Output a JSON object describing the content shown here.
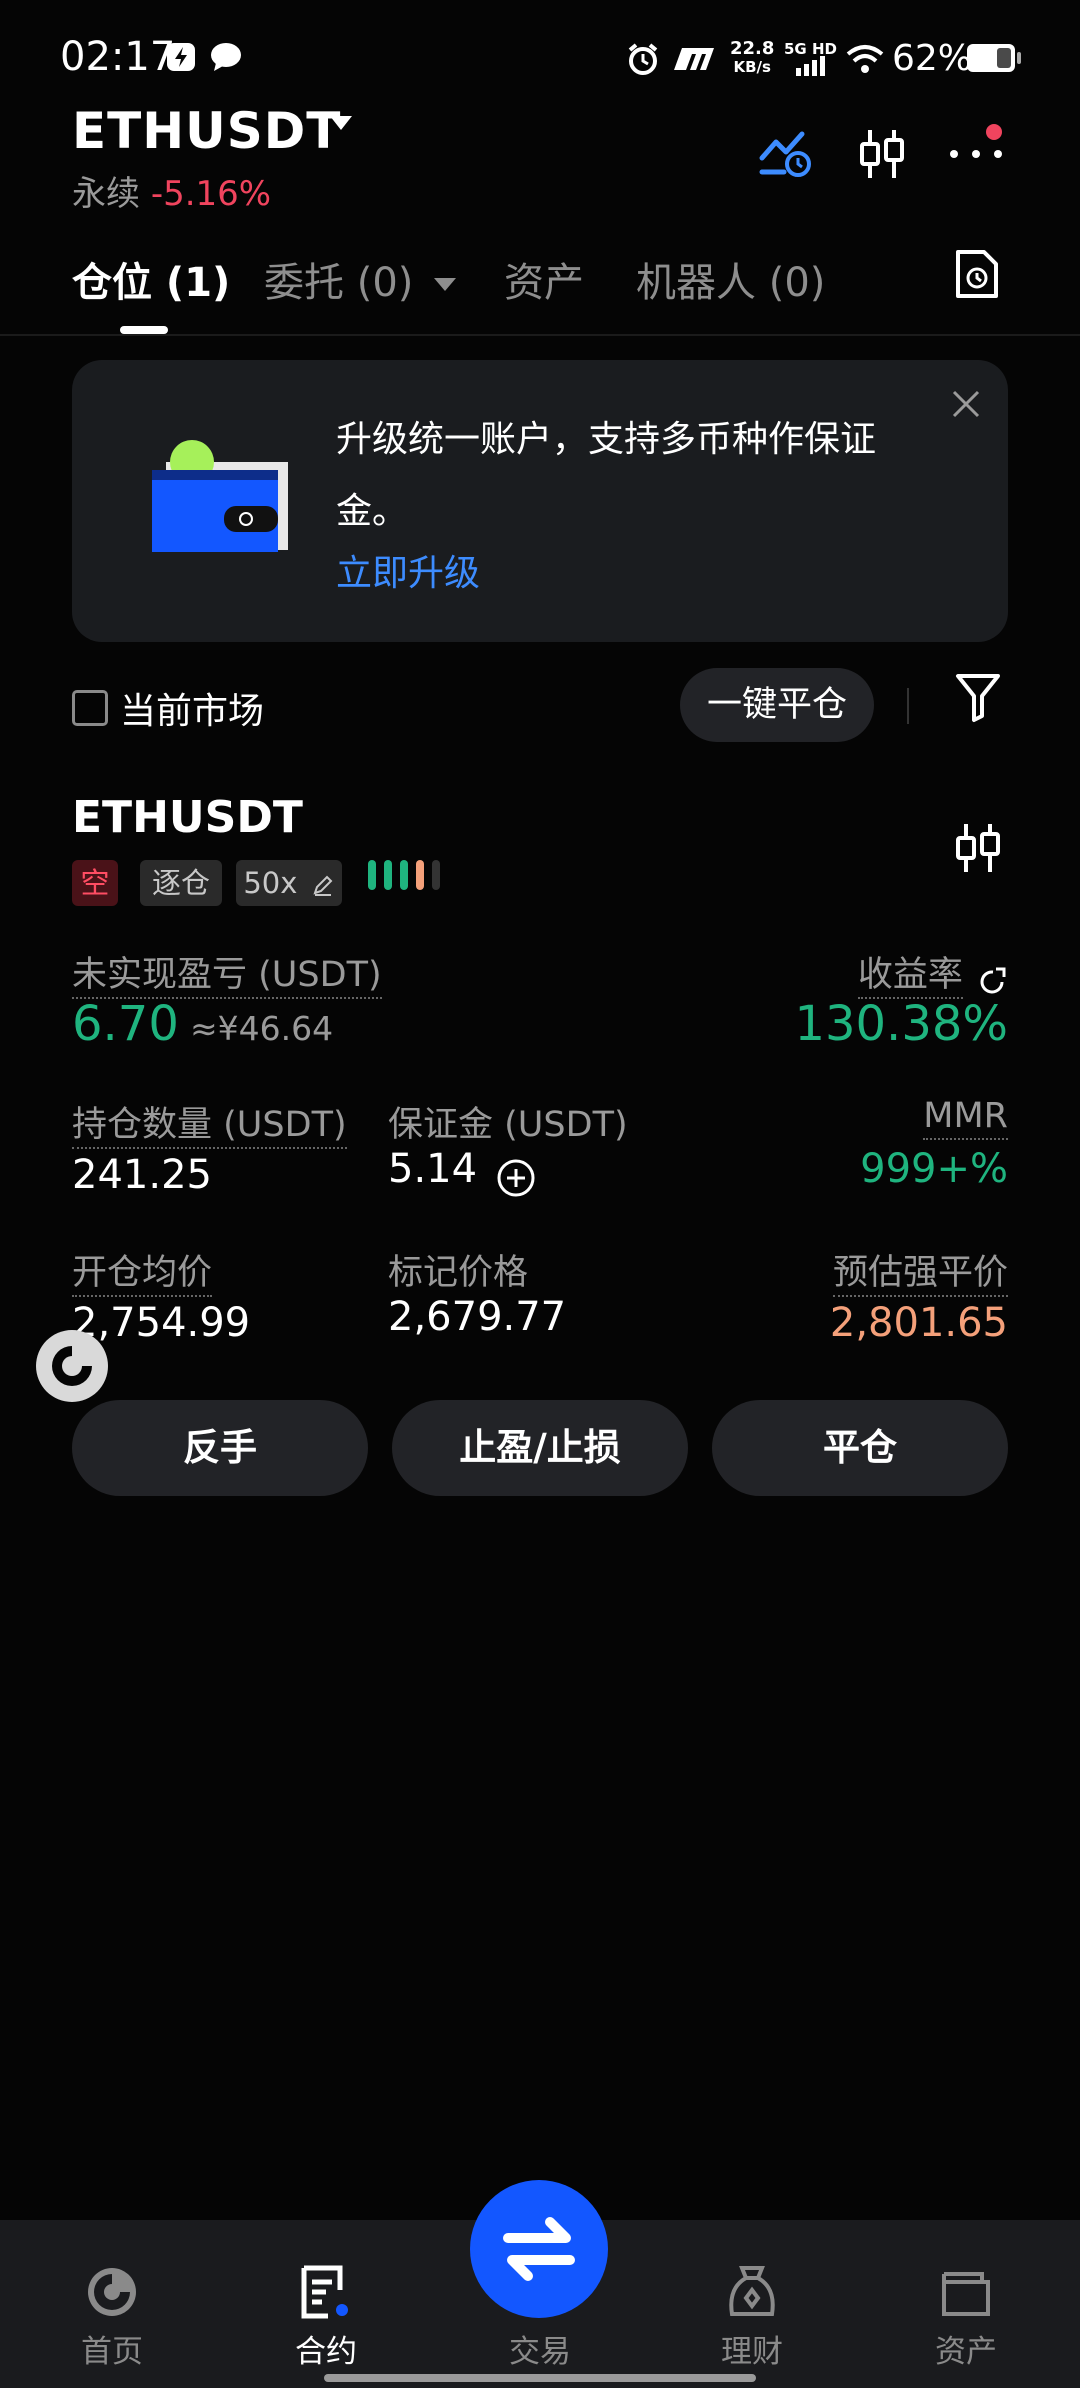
{
  "status_bar": {
    "time": "02:17",
    "network_speed": "22.8",
    "network_unit": "KB/s",
    "network_type": "5G HD",
    "battery": "62%"
  },
  "header": {
    "symbol": "ETHUSDT",
    "contract_type": "永续",
    "change": "-5.16%"
  },
  "tabs": [
    {
      "label": "仓位 (1)",
      "active": true
    },
    {
      "label": "委托 (0)",
      "active": false
    },
    {
      "label": "资产",
      "active": false
    },
    {
      "label": "机器人 (0)",
      "active": false
    }
  ],
  "banner": {
    "text": "升级统一账户，支持多币种作保证金。",
    "link": "立即升级"
  },
  "filters": {
    "current_market": "当前市场",
    "close_all": "一键平仓"
  },
  "position": {
    "symbol": "ETHUSDT",
    "side_tag": "空",
    "margin_mode_tag": "逐仓",
    "leverage_tag": "50x",
    "unrealized_pnl_label": "未实现盈亏 (USDT)",
    "unrealized_pnl": "6.70",
    "unrealized_pnl_cny": "≈¥46.64",
    "roi_label": "收益率",
    "roi": "130.38%",
    "size_label": "持仓数量 (USDT)",
    "size": "241.25",
    "margin_label": "保证金 (USDT)",
    "margin": "5.14",
    "mmr_label": "MMR",
    "mmr": "999+%",
    "entry_price_label": "开仓均价",
    "entry_price": "2,754.99",
    "mark_price_label": "标记价格",
    "mark_price": "2,679.77",
    "liq_price_label": "预估强平价",
    "liq_price": "2,801.65",
    "buttons": {
      "reverse": "反手",
      "tpsl": "止盈/止损",
      "close": "平仓"
    }
  },
  "bottom_nav": [
    {
      "label": "首页",
      "icon": "home-icon"
    },
    {
      "label": "合约",
      "icon": "contract-icon",
      "active": true
    },
    {
      "label": "交易",
      "icon": "swap-icon"
    },
    {
      "label": "理财",
      "icon": "earn-icon"
    },
    {
      "label": "资产",
      "icon": "wallet-icon"
    }
  ],
  "colors": {
    "negative": "#f0445e",
    "positive": "#1fb47f",
    "liquidation": "#f4a07a",
    "accent": "#1357ff",
    "link": "#3d8cff"
  }
}
